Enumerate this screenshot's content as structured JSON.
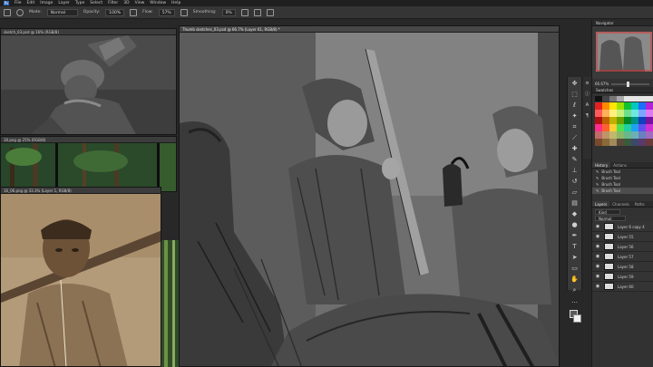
{
  "menubar": {
    "logo": "Ps",
    "items": [
      "File",
      "Edit",
      "Image",
      "Layer",
      "Type",
      "Select",
      "Filter",
      "3D",
      "View",
      "Window",
      "Help"
    ]
  },
  "options": {
    "mode_label": "Mode:",
    "mode_value": "Normal",
    "opacity_label": "Opacity:",
    "opacity_value": "100%",
    "flow_label": "Flow:",
    "flow_value": "57%",
    "smoothing_label": "Smoothing:",
    "smoothing_value": "0%"
  },
  "documents": {
    "doc1_title": "sketch_03.psd @ 16% (RGB/8)",
    "doc2_title": "16.png @ 25% (RGB/8)",
    "doc3_title": "16_06.png @ 33.3% (Layer 1, RGB/8)",
    "main_title": "Thumb sketches_03.psd @ 66.7% (Layer 61, RGB/8) *"
  },
  "panels": {
    "navigator": "Navigator",
    "zoom": "66.67%",
    "swatches": "Swatches",
    "history_tab": "History",
    "actions_tab": "Actions",
    "history_items": [
      "Brush Tool",
      "Brush Tool",
      "Brush Tool",
      "Brush Tool"
    ],
    "layers_tabs": [
      "Layers",
      "Channels",
      "Paths"
    ],
    "kind": "Kind",
    "blend": "Normal",
    "layers": [
      "Layer 6 copy 4",
      "Layer 55",
      "Layer 56",
      "Layer 57",
      "Layer 58",
      "Layer 59",
      "Layer 60"
    ]
  },
  "colors": {
    "app_bg": "#282828",
    "panel_bg": "#323232",
    "accent": "#2d6fbf"
  }
}
